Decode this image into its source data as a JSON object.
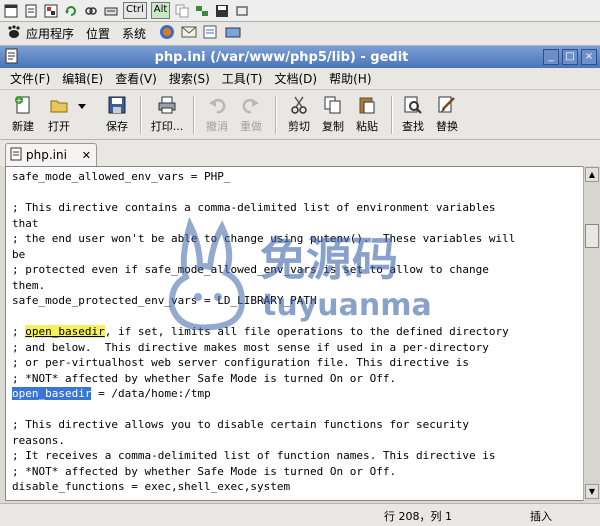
{
  "top_toolbar": {
    "keys": [
      "Ctrl",
      "Alt"
    ]
  },
  "panel": {
    "items": [
      "应用程序",
      "位置",
      "系统"
    ]
  },
  "window": {
    "title": "php.ini (/var/www/php5/lib) - gedit"
  },
  "menu": [
    "文件(F)",
    "编辑(E)",
    "查看(V)",
    "搜索(S)",
    "工具(T)",
    "文档(D)",
    "帮助(H)"
  ],
  "toolbar": {
    "new_label": "新建",
    "open_label": "打开",
    "save_label": "保存",
    "print_label": "打印...",
    "undo_label": "撤消",
    "redo_label": "重做",
    "cut_label": "剪切",
    "copy_label": "复制",
    "paste_label": "粘贴",
    "find_label": "查找",
    "replace_label": "替换"
  },
  "tab": {
    "label": "php.ini"
  },
  "editor": {
    "lines": [
      "safe_mode_allowed_env_vars = PHP_",
      "",
      "; This directive contains a comma-delimited list of environment variables",
      "that",
      "; the end user won't be able to change using putenv().  These variables will",
      "be",
      "; protected even if safe_mode_allowed_env_vars is set to allow to change",
      "them.",
      "safe_mode_protected_env_vars = LD_LIBRARY_PATH",
      "",
      "; open_basedir, if set, limits all file operations to the defined directory",
      "; and below.  This directive makes most sense if used in a per-directory",
      "; or per-virtualhost web server configuration file. This directive is",
      "; *NOT* affected by whether Safe Mode is turned On or Off.",
      "open_basedir = /data/home:/tmp",
      "",
      "; This directive allows you to disable certain functions for security",
      "reasons.",
      "; It receives a comma-delimited list of function names. This directive is",
      "; *NOT* affected by whether Safe Mode is turned On or Off.",
      "disable_functions = exec,shell_exec,system"
    ]
  },
  "status": {
    "position": "行 208，列 1",
    "mode": "插入"
  },
  "watermark": {
    "chinese": "免源码",
    "latin": "tuyuanma"
  }
}
